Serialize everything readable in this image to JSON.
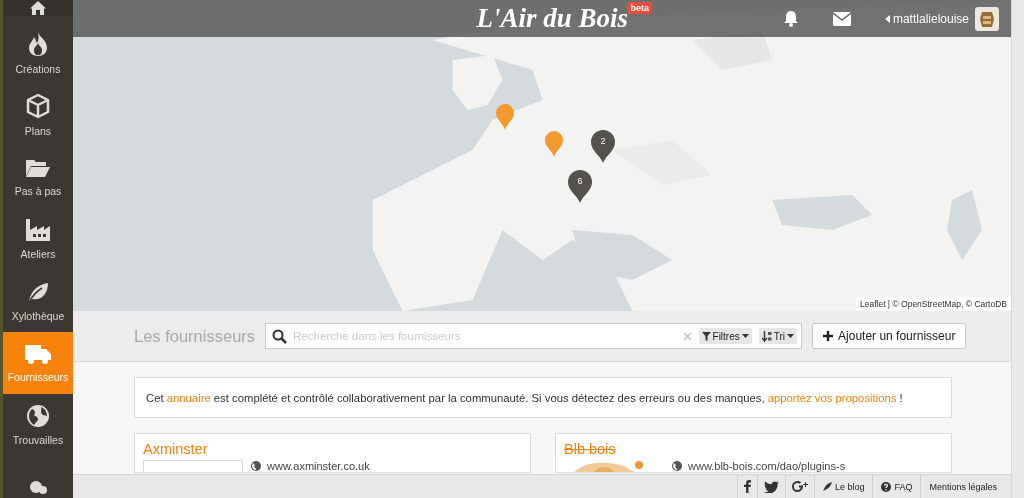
{
  "top_bar": {
    "logo": "L'Air du Bois",
    "badge": "beta",
    "user": {
      "name": "mattlalielouise"
    }
  },
  "sidebar": {
    "items": [
      {
        "label": "Créations",
        "selected": false
      },
      {
        "label": "Plans",
        "selected": false
      },
      {
        "label": "Pas à pas",
        "selected": false
      },
      {
        "label": "Ateliers",
        "selected": false
      },
      {
        "label": "Xylothèque",
        "selected": false
      },
      {
        "label": "Fournisseurs",
        "selected": true
      },
      {
        "label": "Trouvailles",
        "selected": false
      },
      {
        "selected": false
      }
    ]
  },
  "map": {
    "markers": [
      {
        "kind": "pin"
      },
      {
        "kind": "pin"
      },
      {
        "kind": "cluster",
        "count": "2"
      },
      {
        "kind": "cluster",
        "count": "6"
      }
    ],
    "attribution": "Leaflet | © OpenStreetMap, © CartoDB"
  },
  "toolbar": {
    "title": "Les fournisseurs",
    "search": {
      "placeholder": "Recherche dans les fournisseurs"
    },
    "filter_button": "Filtres",
    "sort_button": "Tri",
    "add_button": "Ajouter un fournisseur"
  },
  "notice": [
    {
      "kind": "text",
      "text": "Cet "
    },
    {
      "kind": "link",
      "text": "annuaire"
    },
    {
      "kind": "text",
      "text": " est complété et contrôlé collaborativement par la communauté. Si vous détectez des erreurs ou des manques, "
    },
    {
      "kind": "link",
      "text": "apportez vos propositions"
    },
    {
      "kind": "text",
      "text": " !"
    }
  ],
  "suppliers": [
    {
      "name": "Axminster",
      "struck": false,
      "url": "www.axminster.co.uk"
    },
    {
      "name": "Blb bois",
      "struck": true,
      "url": "www.blb-bois.com/dao/plugins-s"
    }
  ],
  "footer": {
    "links": [
      "Le blog",
      "FAQ",
      "Mentions légales"
    ]
  }
}
